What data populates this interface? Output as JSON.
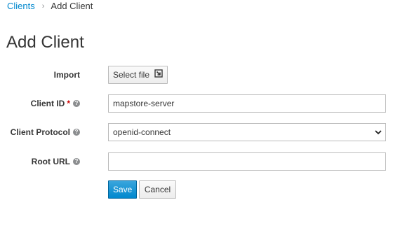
{
  "breadcrumb": {
    "parent": "Clients",
    "separator": "›",
    "current": "Add Client"
  },
  "page_title": "Add Client",
  "form": {
    "import": {
      "label": "Import",
      "button_label": "Select file",
      "button_icon": "import-icon"
    },
    "client_id": {
      "label": "Client ID",
      "required_mark": "*",
      "value": "mapstore-server",
      "help_icon": "question-circle-icon"
    },
    "client_protocol": {
      "label": "Client Protocol",
      "selected": "openid-connect",
      "help_icon": "question-circle-icon"
    },
    "root_url": {
      "label": "Root URL",
      "value": "",
      "help_icon": "question-circle-icon"
    }
  },
  "actions": {
    "save_label": "Save",
    "cancel_label": "Cancel"
  },
  "colors": {
    "link": "#0088ce",
    "primary": "#0088ce",
    "required": "#cc0000",
    "text": "#363636"
  }
}
